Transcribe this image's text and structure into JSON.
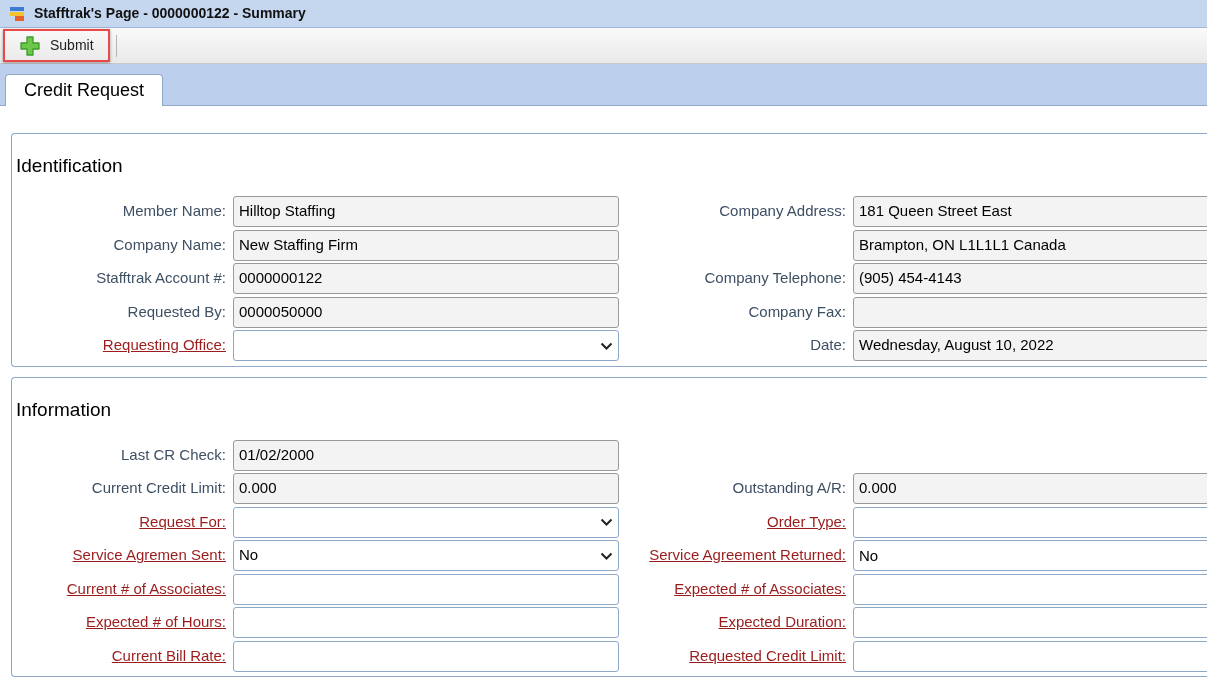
{
  "window": {
    "title": "Stafftrak's Page - 0000000122 - Summary"
  },
  "toolbar": {
    "buttons": [
      {
        "label": "Submit",
        "highlighted": true
      }
    ]
  },
  "tabs": [
    {
      "label": "Credit Request",
      "selected": true
    }
  ],
  "sections": [
    {
      "title": "Identification",
      "rows": [
        {
          "left": {
            "label": "Member Name:",
            "kind": "readonly",
            "value": "Hilltop Staffing",
            "link": false
          },
          "right": {
            "label": "Company Address:",
            "kind": "readonly",
            "value": "181 Queen Street East",
            "link": false
          }
        },
        {
          "left": {
            "label": "Company Name:",
            "kind": "readonly",
            "value": "New Staffing Firm",
            "link": false
          },
          "right": {
            "kind": "readonly",
            "value": "Brampton, ON L1L1L1 Canada"
          }
        },
        {
          "left": {
            "label": "Stafftrak Account #:",
            "kind": "readonly",
            "value": "0000000122",
            "link": false
          },
          "right": {
            "label": "Company Telephone:",
            "kind": "readonly",
            "value": "(905) 454-4143",
            "link": false
          }
        },
        {
          "left": {
            "label": "Requested By:",
            "kind": "readonly",
            "value": "0000050000",
            "link": false
          },
          "right": {
            "label": "Company Fax:",
            "kind": "readonly",
            "link": false
          }
        },
        {
          "left": {
            "label": "Requesting Office:",
            "kind": "select",
            "link": true
          },
          "right": {
            "label": "Date:",
            "kind": "readonly",
            "value": "Wednesday, August 10, 2022",
            "link": false
          }
        }
      ]
    },
    {
      "title": "Information",
      "rows": [
        {
          "left": {
            "label": "Last CR Check:",
            "kind": "readonly",
            "value": "01/02/2000",
            "link": false
          }
        },
        {
          "left": {
            "label": "Current Credit Limit:",
            "kind": "readonly",
            "value": "0.000",
            "link": false
          },
          "right": {
            "label": "Outstanding A/R:",
            "kind": "readonly",
            "value": "0.000",
            "link": false
          }
        },
        {
          "left": {
            "label": "Request For:",
            "kind": "select",
            "link": true
          },
          "right": {
            "label": "Order Type:",
            "kind": "input",
            "link": true
          }
        },
        {
          "left": {
            "label": "Service Agremen Sent:",
            "kind": "select",
            "value": "No",
            "link": true
          },
          "right": {
            "label": "Service Agreement Returned:",
            "kind": "input",
            "value": "No",
            "link": true
          }
        },
        {
          "left": {
            "label": "Current # of Associates:",
            "kind": "input",
            "link": true
          },
          "right": {
            "label": "Expected # of Associates:",
            "kind": "input",
            "link": true
          }
        },
        {
          "left": {
            "label": "Expected # of Hours:",
            "kind": "input",
            "link": true
          },
          "right": {
            "label": "Expected Duration:",
            "kind": "input",
            "link": true
          }
        },
        {
          "left": {
            "label": "Current Bill Rate:",
            "kind": "input",
            "link": true
          },
          "right": {
            "label": "Requested Credit Limit:",
            "kind": "input",
            "link": true
          }
        }
      ]
    }
  ]
}
